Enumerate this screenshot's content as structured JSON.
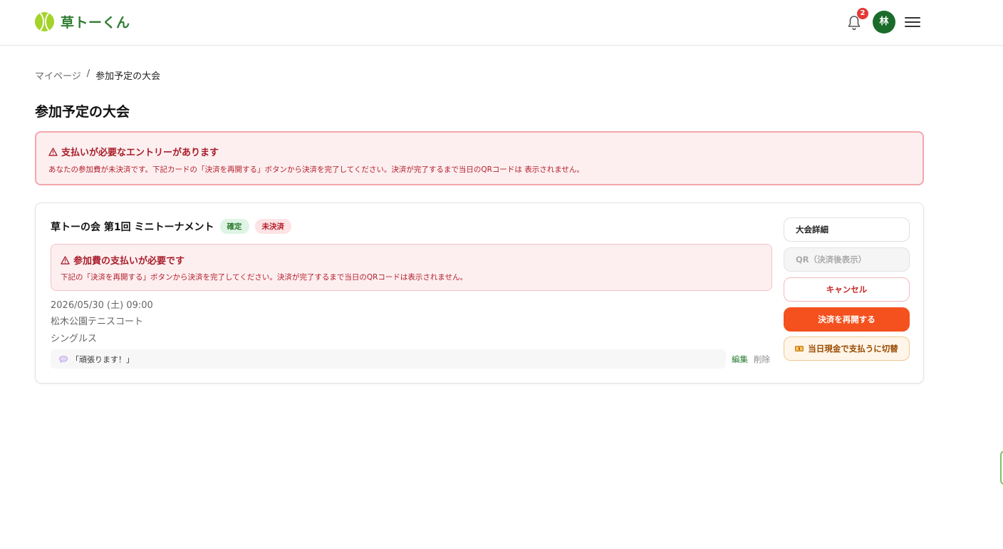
{
  "app": {
    "name": "草トーくん",
    "notification_count": "2",
    "avatar_initial": "林"
  },
  "breadcrumb": {
    "home": "マイページ",
    "separator": "/",
    "current": "参加予定の大会"
  },
  "page": {
    "title": "参加予定の大会"
  },
  "alert_main": {
    "icon": "warning-icon",
    "title": "支払いが必要なエントリーがあります",
    "text": "あなたの参加費が未決済です。下記カードの「決済を再開する」ボタンから決済を完了してください。決済が完了するまで当日のQRコードは 表示されません。"
  },
  "entry": {
    "title": "草トーの会 第1回 ミニトーナメント",
    "badge_status": "確定",
    "badge_payment": "未決済",
    "alert_title": "参加費の支払いが必要です",
    "alert_text": "下記の「決済を再開する」ボタンから決済を完了してください。決済が完了するまで当日のQRコードは表示されません。",
    "datetime": "2026/05/30 (土) 09:00",
    "venue": "松木公園テニスコート",
    "format": "シングルス",
    "comment": "「頑張ります！」",
    "edit_label": "編集",
    "delete_label": "削除",
    "buttons": {
      "detail": "大会詳細",
      "qr": "QR（決済後表示）",
      "cancel": "キャンセル",
      "resume_payment": "決済を再開する",
      "switch_cash": "当日現金で支払うに切替"
    }
  },
  "colors": {
    "brand_green": "#2e7d32",
    "alert_red": "#b3202d",
    "accent_orange": "#f4511e"
  }
}
